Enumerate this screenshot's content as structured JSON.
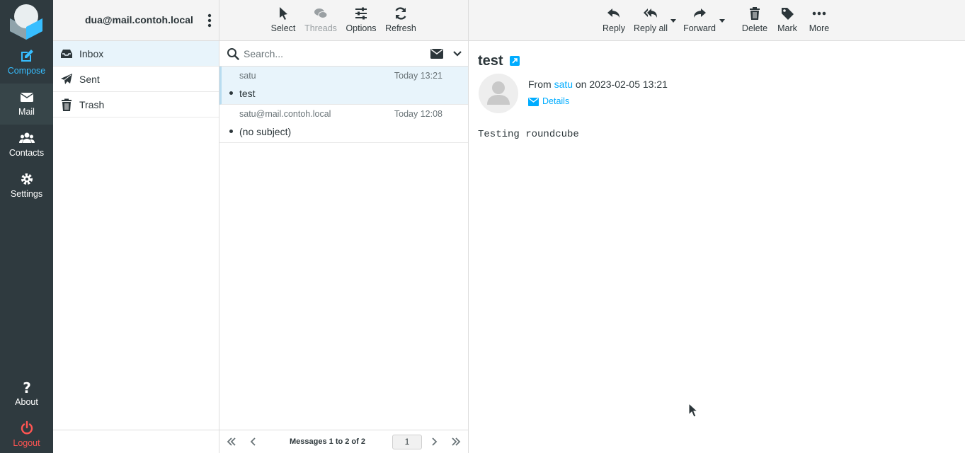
{
  "nav": {
    "compose": "Compose",
    "mail": "Mail",
    "contacts": "Contacts",
    "settings": "Settings",
    "about": "About",
    "logout": "Logout"
  },
  "account": "dua@mail.contoh.local",
  "folders": [
    {
      "label": "Inbox",
      "icon": "inbox-icon",
      "active": true
    },
    {
      "label": "Sent",
      "icon": "paper-plane-icon",
      "active": false
    },
    {
      "label": "Trash",
      "icon": "trash-icon",
      "active": false
    }
  ],
  "list_toolbar": {
    "select": "Select",
    "threads": "Threads",
    "options": "Options",
    "refresh": "Refresh"
  },
  "search": {
    "placeholder": "Search..."
  },
  "messages": [
    {
      "from": "satu",
      "date": "Today 13:21",
      "subject": "test",
      "selected": true
    },
    {
      "from": "satu@mail.contoh.local",
      "date": "Today 12:08",
      "subject": "(no subject)",
      "selected": false
    }
  ],
  "pager": {
    "info": "Messages 1 to 2 of 2",
    "page": "1"
  },
  "preview_toolbar": {
    "reply": "Reply",
    "reply_all": "Reply all",
    "forward": "Forward",
    "delete": "Delete",
    "mark": "Mark",
    "more": "More"
  },
  "message": {
    "subject": "test",
    "from_prefix": "From",
    "from_name": "satu",
    "date_text": "on 2023-02-05 13:21",
    "details": "Details",
    "body": "Testing roundcube"
  },
  "colors": {
    "accent": "#37beff",
    "link": "#00acff",
    "logout": "#ff5552",
    "nav_bg": "#2f3a3f",
    "selected_bg": "#e8f4fb"
  }
}
